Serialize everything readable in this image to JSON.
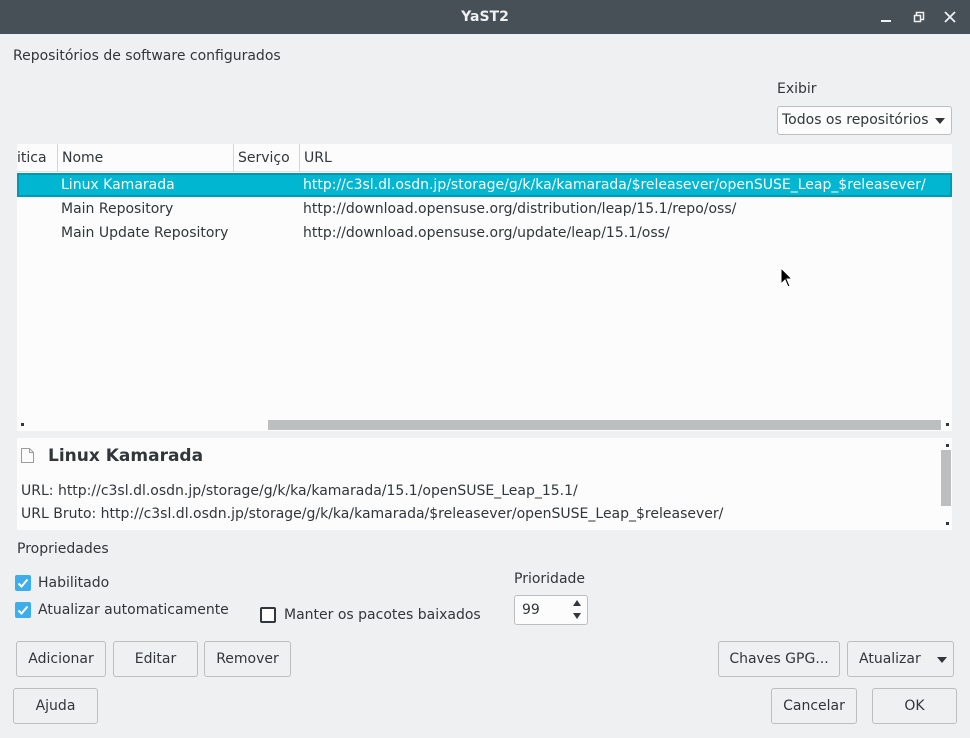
{
  "window": {
    "title": "YaST2"
  },
  "heading": "Repositórios de software configurados",
  "filter": {
    "label": "Exibir",
    "selected": "Todos os repositórios"
  },
  "table": {
    "columns": [
      "itica",
      "Nome",
      "Serviço",
      "URL"
    ],
    "rows": [
      {
        "name": "Linux Kamarada",
        "service": "",
        "url": "http://c3sl.dl.osdn.jp/storage/g/k/ka/kamarada/$releasever/openSUSE_Leap_$releasever/",
        "selected": true
      },
      {
        "name": "Main Repository",
        "service": "",
        "url": "http://download.opensuse.org/distribution/leap/15.1/repo/oss/",
        "selected": false
      },
      {
        "name": "Main Update Repository",
        "service": "",
        "url": "http://download.opensuse.org/update/leap/15.1/oss/",
        "selected": false
      }
    ]
  },
  "detail": {
    "icon": "document-icon",
    "name": "Linux Kamarada",
    "url_line": "URL: http://c3sl.dl.osdn.jp/storage/g/k/ka/kamarada/15.1/openSUSE_Leap_15.1/",
    "raw_url_line": "URL Bruto: http://c3sl.dl.osdn.jp/storage/g/k/ka/kamarada/$releasever/openSUSE_Leap_$releasever/"
  },
  "properties": {
    "label": "Propriedades",
    "enabled": {
      "label": "Habilitado",
      "checked": true
    },
    "auto_refresh": {
      "label": "Atualizar automaticamente",
      "checked": true
    },
    "keep_packages": {
      "label": "Manter os pacotes baixados",
      "checked": false
    },
    "priority": {
      "label": "Prioridade",
      "value": "99"
    }
  },
  "buttons": {
    "add": "Adicionar",
    "edit": "Editar",
    "remove": "Remover",
    "gpg_keys": "Chaves GPG...",
    "refresh": "Atualizar",
    "help": "Ajuda",
    "cancel": "Cancelar",
    "ok": "OK"
  },
  "colors": {
    "titlebar": "#475057",
    "selection": "#00b6d1",
    "checkbox_on": "#3daee9",
    "window_bg": "#eff0f1"
  }
}
